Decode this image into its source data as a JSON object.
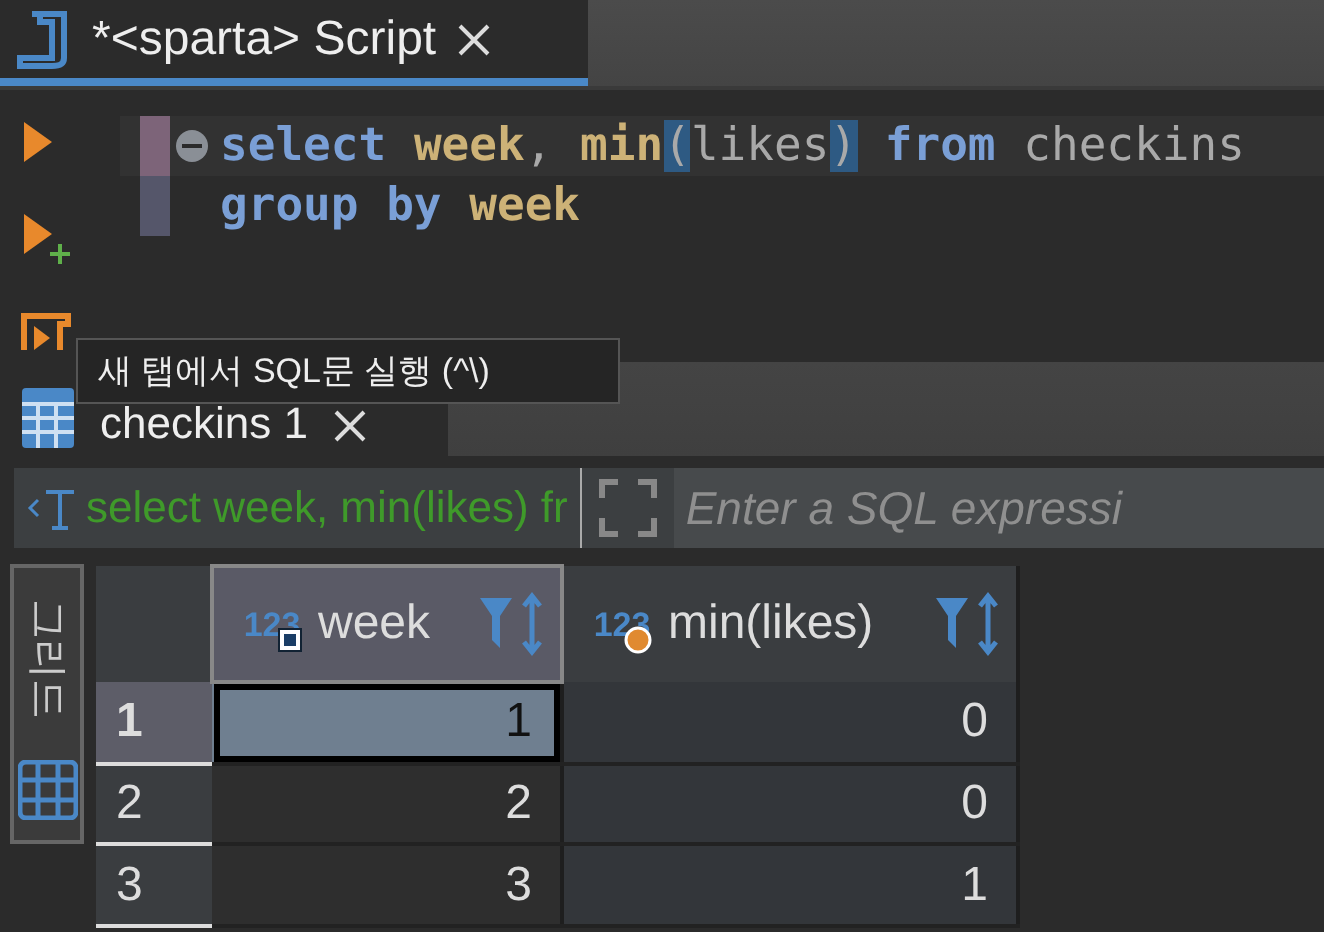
{
  "editor_tab": {
    "title": "*<sparta> Script",
    "selected": true
  },
  "editor": {
    "lines": [
      {
        "current": true,
        "foldable": true,
        "tokens": [
          {
            "text": "select ",
            "kind": "keyword"
          },
          {
            "text": "week",
            "kind": "column"
          },
          {
            "text": ", ",
            "kind": "plain"
          },
          {
            "text": "min",
            "kind": "column"
          },
          {
            "text": "(",
            "kind": "bracket"
          },
          {
            "text": "likes",
            "kind": "plain"
          },
          {
            "text": ")",
            "kind": "bracket"
          },
          {
            "text": " from",
            "kind": "keyword"
          },
          {
            "text": " checkins",
            "kind": "plain"
          }
        ]
      },
      {
        "current": false,
        "foldable": false,
        "tokens": [
          {
            "text": "group by ",
            "kind": "keyword"
          },
          {
            "text": "week",
            "kind": "column"
          }
        ]
      }
    ]
  },
  "tooltip": "새 탭에서 SQL문 실행 (^\\)",
  "result_tab": {
    "title": "checkins 1",
    "selected": true
  },
  "filter": {
    "query": "select week, min(likes) fr",
    "placeholder": "Enter a SQL expressi"
  },
  "side_tabs": [
    {
      "label": "그리드",
      "selected": true
    }
  ],
  "table": {
    "columns": [
      {
        "type": "123",
        "name": "week",
        "selected": true,
        "kind": "key"
      },
      {
        "type": "123",
        "name": "min(likes)",
        "selected": false,
        "kind": "dot"
      }
    ],
    "rows": [
      {
        "number": "1",
        "selected": true,
        "cells": [
          {
            "value": "1",
            "selected": true
          },
          {
            "value": "0",
            "selected": false
          }
        ]
      },
      {
        "number": "2",
        "selected": false,
        "cells": [
          {
            "value": "2",
            "selected": false
          },
          {
            "value": "0",
            "selected": false
          }
        ]
      },
      {
        "number": "3",
        "selected": false,
        "cells": [
          {
            "value": "3",
            "selected": false
          },
          {
            "value": "1",
            "selected": false
          }
        ]
      }
    ]
  }
}
